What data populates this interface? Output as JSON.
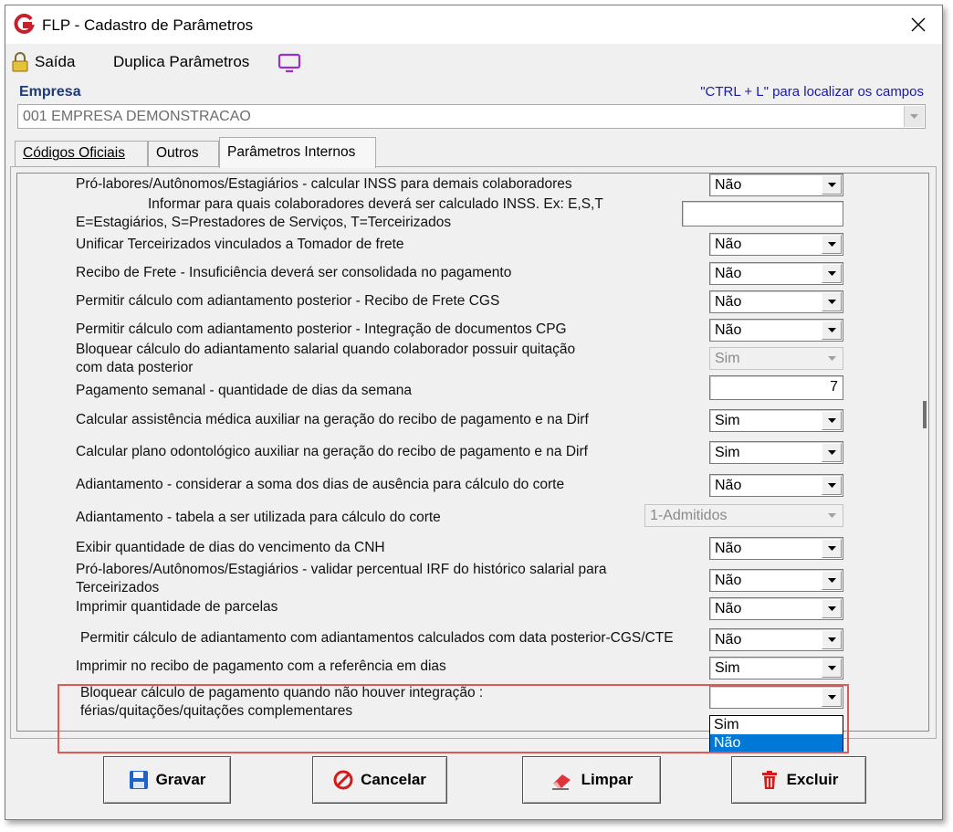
{
  "window": {
    "title": "FLP - Cadastro de Parâmetros"
  },
  "toolbar": {
    "sair_label": "Saída",
    "duplicate_label": "Duplica Parâmetros"
  },
  "empresa": {
    "label": "Empresa",
    "hint": "\"CTRL + L\" para localizar os campos",
    "value": "001 EMPRESA DEMONSTRACAO"
  },
  "tabs": [
    {
      "label": "Códigos Oficiais"
    },
    {
      "label": "Outros"
    },
    {
      "label": "Parâmetros Internos"
    }
  ],
  "rows": [
    {
      "label": "Pró-labores/Autônomos/Estagiários - calcular INSS para demais colaboradores",
      "value": "Não"
    },
    {
      "label1": "Informar para quais colaboradores deverá ser calculado INSS. Ex: E,S,T",
      "label2": "E=Estagiários, S=Prestadores de Serviços, T=Terceirizados",
      "value": ""
    },
    {
      "label": "Unificar Terceirizados vinculados a Tomador de frete",
      "value": "Não"
    },
    {
      "label": "Recibo de Frete - Insuficiência deverá ser consolidada no pagamento",
      "value": "Não"
    },
    {
      "label": "Permitir cálculo com adiantamento posterior - Recibo de Frete CGS",
      "value": "Não"
    },
    {
      "label": "Permitir cálculo com adiantamento posterior - Integração de documentos CPG",
      "value": "Não"
    },
    {
      "label1": "Bloquear cálculo do adiantamento salarial quando colaborador possuir quitação",
      "label2": "com data posterior",
      "value": "Sim"
    },
    {
      "label": "Pagamento semanal - quantidade de dias da  semana",
      "value": "7"
    },
    {
      "label": "Calcular assistência médica auxiliar na geração do recibo de pagamento e na Dirf",
      "value": "Sim"
    },
    {
      "label": "Calcular plano odontológico auxiliar na geração do recibo de pagamento e na Dirf",
      "value": "Sim"
    },
    {
      "label": "Adiantamento - considerar a soma dos dias de ausência para cálculo do corte",
      "value": "Não"
    },
    {
      "label": "Adiantamento - tabela a ser utilizada para cálculo do corte",
      "value": "1-Admitidos"
    },
    {
      "label": "Exibir quantidade de dias do vencimento da CNH",
      "value": "Não"
    },
    {
      "label1": "Pró-labores/Autônomos/Estagiários - validar percentual IRF do  histórico salarial para",
      "label2": "Terceirizados",
      "value": "Não"
    },
    {
      "label": "Imprimir quantidade de parcelas",
      "value": "Não"
    },
    {
      "label": "Permitir cálculo de adiantamento com adiantamentos calculados com data posterior-CGS/CTE",
      "value": "Não"
    },
    {
      "label": "Imprimir no recibo de pagamento com a referência em dias",
      "value": "Sim"
    },
    {
      "label1": "Bloquear cálculo de pagamento quando não houver integração :",
      "label2": "férias/quitações/quitações complementares",
      "value": ""
    }
  ],
  "dropdown": {
    "options": [
      "Sim",
      "Não"
    ],
    "selected": "Não"
  },
  "buttons": {
    "gravar": "Gravar",
    "cancelar": "Cancelar",
    "limpar": "Limpar",
    "excluir": "Excluir"
  },
  "colors": {
    "empresa_label": "#1f3a7a",
    "hint": "#1a1aa8",
    "selection": "#0078d7",
    "highlight_border": "#e05858",
    "logo": "#c8202a"
  },
  "icons": [
    "app-logo-icon",
    "close-icon",
    "lock-icon",
    "monitor-icon",
    "chevron-down-icon",
    "save-icon",
    "cancel-icon",
    "eraser-icon",
    "trash-icon"
  ]
}
